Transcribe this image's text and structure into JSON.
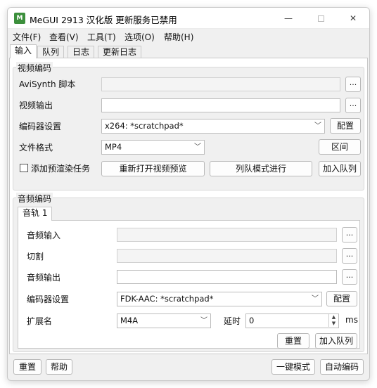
{
  "window": {
    "icon_text": "M",
    "title": "MeGUI 2913 汉化版 更新服务已禁用",
    "minimize": "—",
    "close": "✕"
  },
  "menu": [
    "文件(F)",
    "查看(V)",
    "工具(T)",
    "选项(O)",
    "帮助(H)"
  ],
  "tabs": [
    "输入",
    "队列",
    "日志",
    "更新日志"
  ],
  "video": {
    "group_title": "视频编码",
    "avisynth_label": "AviSynth 脚本",
    "avisynth_value": "",
    "output_label": "视频输出",
    "output_value": "",
    "encoder_label": "编码器设置",
    "encoder_value": "x264: *scratchpad*",
    "config_button": "配置",
    "format_label": "文件格式",
    "format_value": "MP4",
    "zone_button": "区间",
    "prerender_label": "添加预渲染任务",
    "prerender_checked": false,
    "reopen_button": "重新打开视频预览",
    "queue_mode_button": "列队模式进行",
    "add_queue_button": "加入队列",
    "browse": "..."
  },
  "audio": {
    "group_title": "音频编码",
    "track_tab": "音轨 1",
    "input_label": "音频输入",
    "input_value": "",
    "cut_label": "切割",
    "cut_value": "",
    "output_label": "音频输出",
    "output_value": "",
    "encoder_label": "编码器设置",
    "encoder_value": "FDK-AAC: *scratchpad*",
    "config_button": "配置",
    "ext_label": "扩展名",
    "ext_value": "M4A",
    "delay_label": "延时",
    "delay_value": "0",
    "delay_unit": "ms",
    "reset_button": "重置",
    "add_queue_button": "加入队列",
    "browse": "..."
  },
  "footer": {
    "reset_button": "重置",
    "help_button": "帮助",
    "oneclick_button": "一键模式",
    "autoencode_button": "自动编码"
  }
}
